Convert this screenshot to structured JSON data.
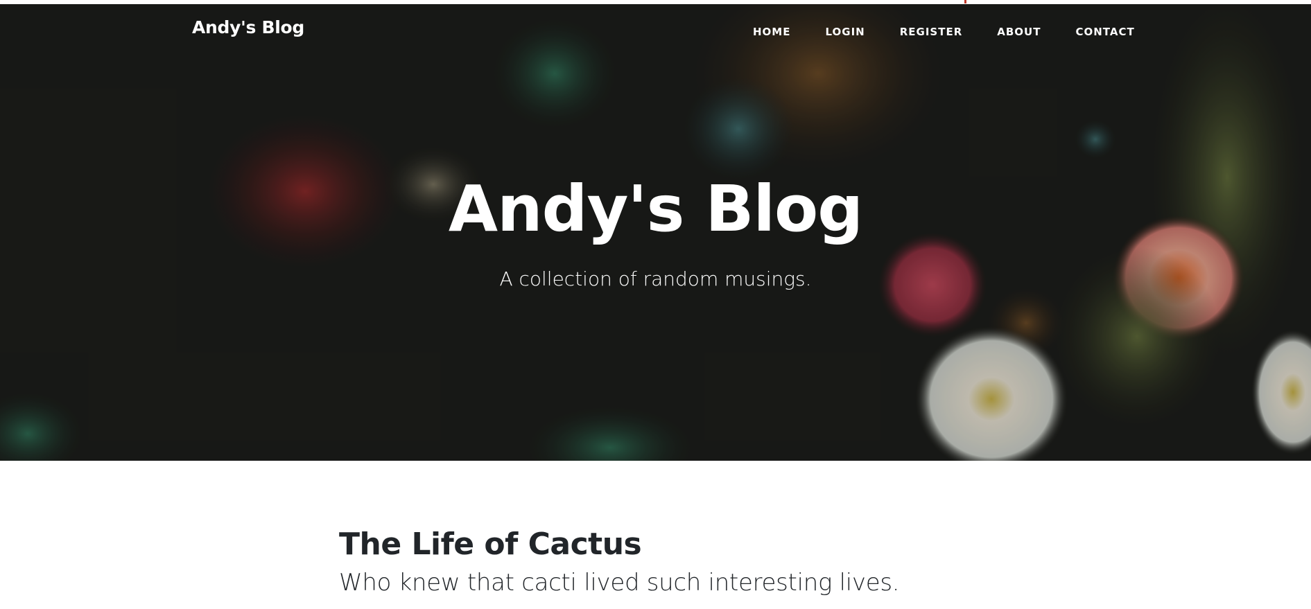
{
  "navbar": {
    "brand": "Andy's Blog",
    "links": [
      {
        "label": "HOME"
      },
      {
        "label": "LOGIN"
      },
      {
        "label": "REGISTER"
      },
      {
        "label": "ABOUT"
      },
      {
        "label": "CONTACT"
      }
    ]
  },
  "hero": {
    "title": "Andy's Blog",
    "subtitle": "A collection of random musings."
  },
  "posts": [
    {
      "title": "The Life of Cactus",
      "subtitle": "Who knew that cacti lived such interesting lives."
    }
  ]
}
